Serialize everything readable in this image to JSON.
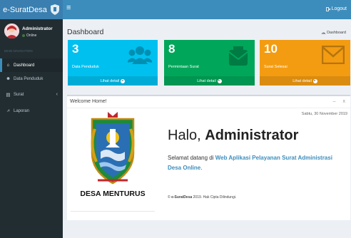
{
  "app": {
    "name": "e-SuratDesa"
  },
  "header": {
    "toggle_icon": "bars-icon",
    "logout_label": "Logout"
  },
  "user": {
    "name": "Administrator",
    "status": "Online"
  },
  "sidebar": {
    "header": "MAIN NAVIGATION",
    "items": [
      {
        "label": "Dashboard",
        "icon": "home-icon",
        "active": true
      },
      {
        "label": "Data Penduduk",
        "icon": "users-icon",
        "active": false
      },
      {
        "label": "Surat",
        "icon": "file-icon",
        "active": false
      },
      {
        "label": "Laporan",
        "icon": "chart-icon",
        "active": false
      }
    ]
  },
  "page": {
    "title": "Dashboard",
    "breadcrumb": "Dashboard"
  },
  "stats": [
    {
      "value": "3",
      "label": "Data Penduduk",
      "link": "Lihat detail",
      "color": "#00c0ef",
      "icon": "users-icon"
    },
    {
      "value": "8",
      "label": "Permintaan Surat",
      "link": "Lihat detail",
      "color": "#00a65a",
      "icon": "mail-open-icon"
    },
    {
      "value": "10",
      "label": "Surat Selesai",
      "link": "Lihat detail",
      "color": "#f39c12",
      "icon": "envelope-icon"
    }
  ],
  "welcome": {
    "title": "Welcome Home!",
    "minimize": "–",
    "close": "x",
    "date": "Sabtu, 30 November 2019",
    "greeting_prefix": "Halo, ",
    "greeting_name": "Administrator",
    "desc_prefix": "Selamat datang di ",
    "desc_link": "Web Aplikasi Pelayanan Surat Administrasi Desa Online",
    "desc_suffix": ".",
    "village": "DESA MENTURUS",
    "footer_prefix": "© ",
    "footer_brand": "e-SuratDesa",
    "footer_suffix": " 2019. Hak Cipta Dilindungi."
  }
}
